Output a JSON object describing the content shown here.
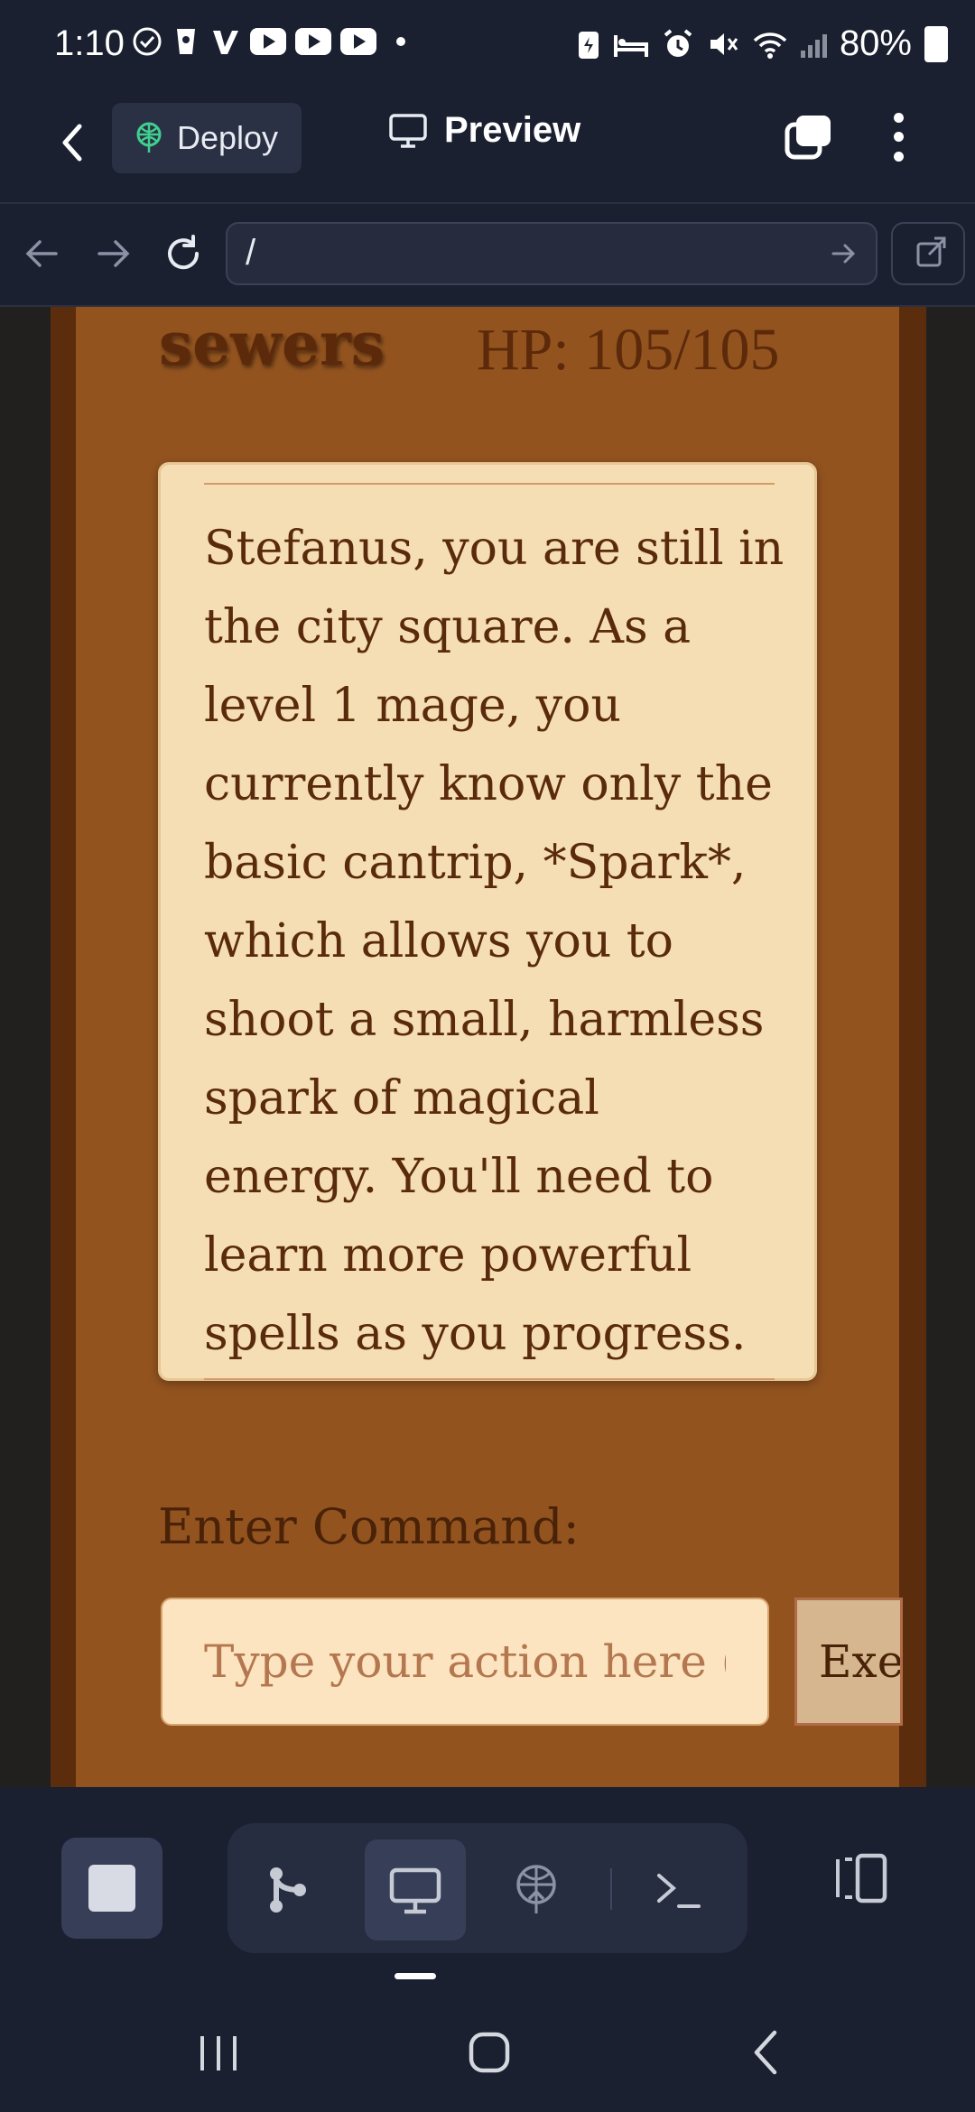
{
  "status_bar": {
    "time": "1:10",
    "battery": "80%"
  },
  "header": {
    "deploy_label": "Deploy",
    "preview_label": "Preview"
  },
  "url_bar": {
    "url": "/"
  },
  "game": {
    "location": "sewers",
    "hp": "HP: 105/105",
    "story": "Stefanus, you are still in the city square.  As a level 1 mage, you currently know only the basic cantrip, *Spark*, which allows you to shoot a small, harmless spark of magical energy.  You'll need to learn more powerful spells as you progress.",
    "command_label": "Enter Command:",
    "command_placeholder": "Type your action here (e.",
    "execute_label": "Execute"
  },
  "colors": {
    "frame_dark": "#5b2d0d",
    "frame_wood": "#92531f",
    "parchment": "#f5deb3",
    "ink": "#5a2a0c",
    "app_bg": "#1b2030"
  },
  "toolbar": {
    "icons": [
      "stop-icon",
      "git-branch-icon",
      "monitor-icon",
      "deploy-icon",
      "terminal-icon",
      "split-panel-icon"
    ]
  }
}
